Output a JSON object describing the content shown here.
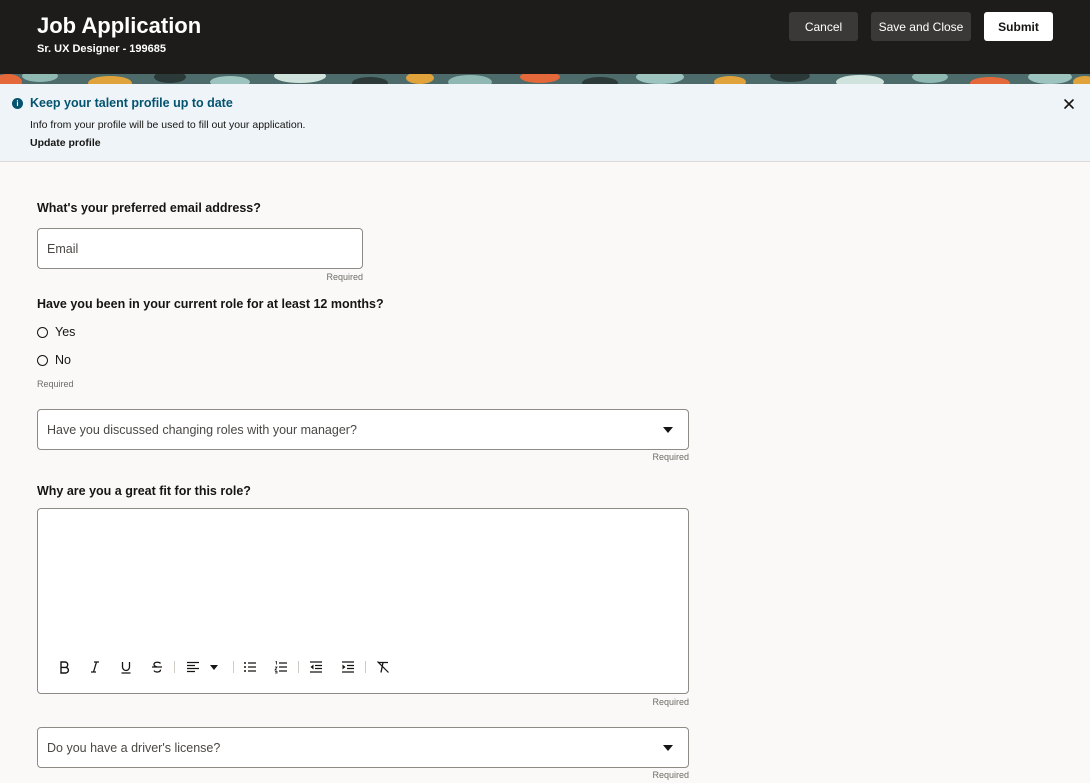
{
  "header": {
    "title": "Job Application",
    "subtitle": "Sr. UX Designer - 199685",
    "cancel_label": "Cancel",
    "save_close_label": "Save and Close",
    "submit_label": "Submit"
  },
  "message": {
    "title": "Keep your talent profile up to date",
    "text": "Info from your profile will be used to fill out your application.",
    "link": "Update profile",
    "icon": "info-icon",
    "close_icon": "close-icon"
  },
  "form": {
    "email": {
      "question": "What's your preferred email address?",
      "placeholder": "Email",
      "value": "",
      "required": "Required"
    },
    "current_role": {
      "question": "Have you been in your current role for at least 12 months?",
      "options": [
        "Yes",
        "No"
      ],
      "required": "Required"
    },
    "discussed_manager": {
      "placeholder": "Have you discussed changing roles with your manager?",
      "required": "Required"
    },
    "great_fit": {
      "question": "Why are you a great fit for this role?",
      "required": "Required",
      "toolbar": [
        "bold-icon",
        "italic-icon",
        "underline-icon",
        "strikethrough-icon",
        "align-left-icon",
        "bulleted-list-icon",
        "numbered-list-icon",
        "outdent-icon",
        "indent-icon",
        "clear-formatting-icon"
      ]
    },
    "drivers_license": {
      "placeholder": "Do you have a driver's license?",
      "required": "Required"
    }
  },
  "colors": {
    "header_bg": "#1d1c1b",
    "message_bg": "#eef4f8",
    "message_accent": "#04536f",
    "page_bg": "#faf9f7"
  }
}
